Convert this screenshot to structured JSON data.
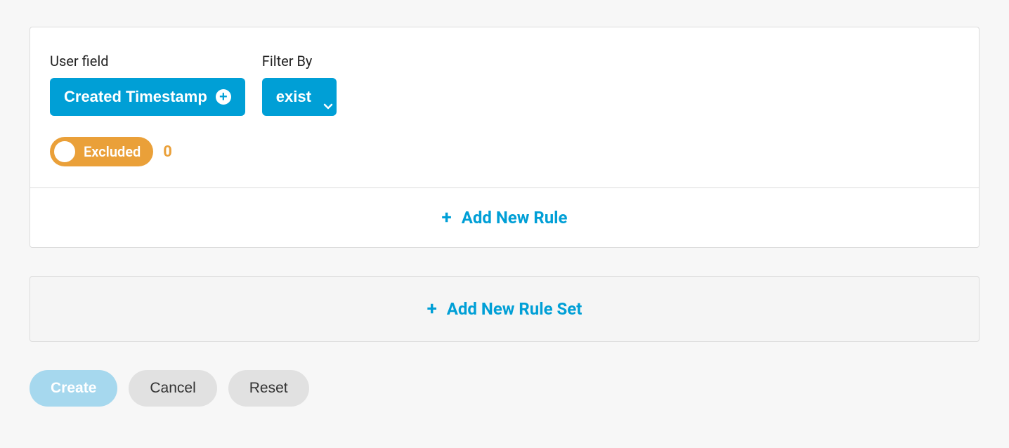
{
  "rule": {
    "user_field_label": "User field",
    "user_field_value": "Created Timestamp",
    "filter_by_label": "Filter By",
    "filter_by_value": "exist",
    "toggle_label": "Excluded",
    "toggle_count": "0"
  },
  "actions": {
    "add_rule": "Add New Rule",
    "add_rule_set": "Add New Rule Set",
    "create": "Create",
    "cancel": "Cancel",
    "reset": "Reset"
  }
}
